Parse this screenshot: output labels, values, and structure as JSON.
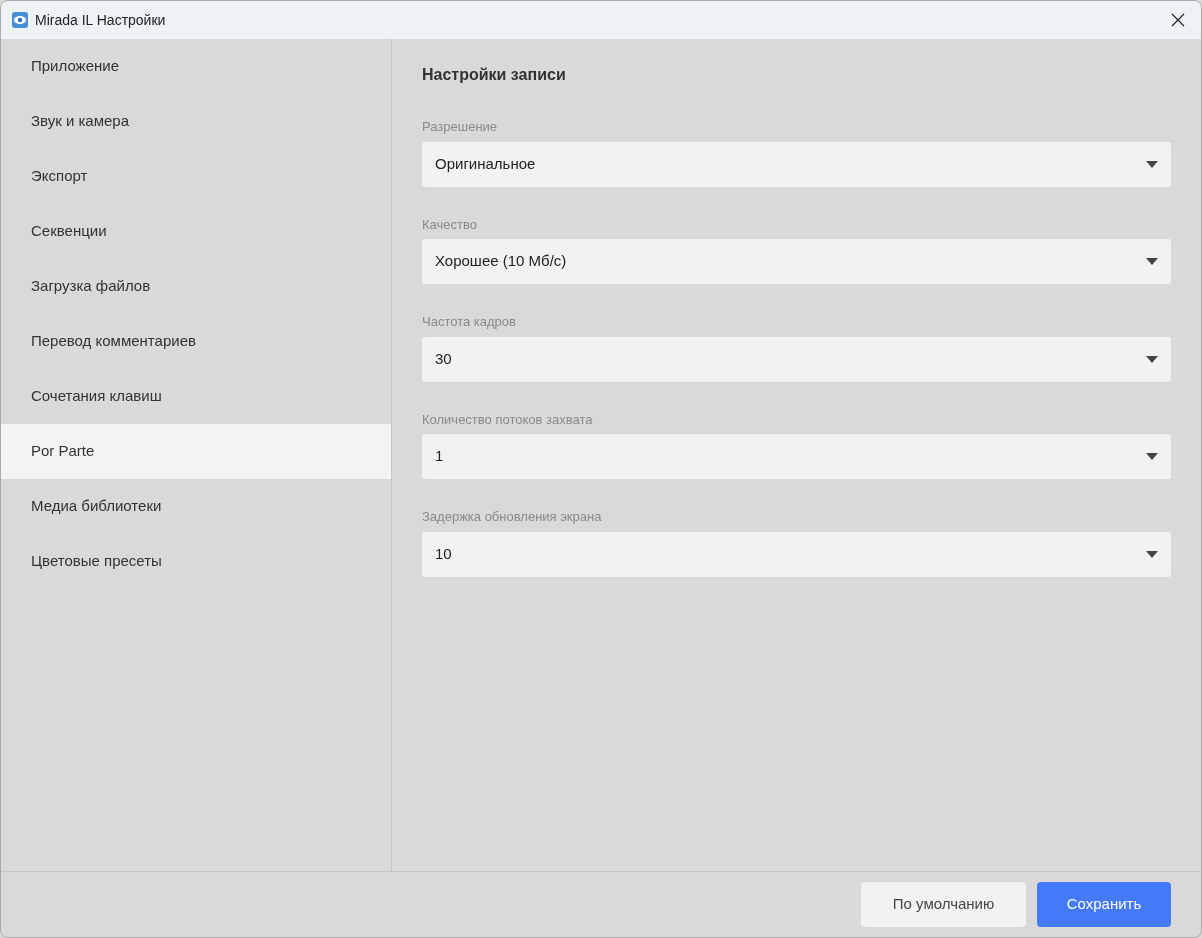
{
  "window": {
    "title": "Mirada IL Настройки"
  },
  "sidebar": {
    "items": [
      {
        "label": "Приложение",
        "selected": false
      },
      {
        "label": "Звук и камера",
        "selected": false
      },
      {
        "label": "Экспорт",
        "selected": false
      },
      {
        "label": "Секвенции",
        "selected": false
      },
      {
        "label": "Загрузка файлов",
        "selected": false
      },
      {
        "label": "Перевод комментариев",
        "selected": false
      },
      {
        "label": "Сочетания клавиш",
        "selected": false
      },
      {
        "label": "Por Parte",
        "selected": true
      },
      {
        "label": "Медиа библиотеки",
        "selected": false
      },
      {
        "label": "Цветовые пресеты",
        "selected": false
      }
    ]
  },
  "panel": {
    "title": "Настройки записи",
    "fields": [
      {
        "label": "Разрешение",
        "value": "Оригинальное"
      },
      {
        "label": "Качество",
        "value": "Хорошее (10 Мб/с)"
      },
      {
        "label": "Частота кадров",
        "value": "30"
      },
      {
        "label": "Количество потоков захвата",
        "value": "1"
      },
      {
        "label": "Задержка обновления экрана",
        "value": "10"
      }
    ]
  },
  "buttons": [
    {
      "label": "По умолчанию",
      "kind": "secondary"
    },
    {
      "label": "Сохранить",
      "kind": "primary"
    }
  ]
}
